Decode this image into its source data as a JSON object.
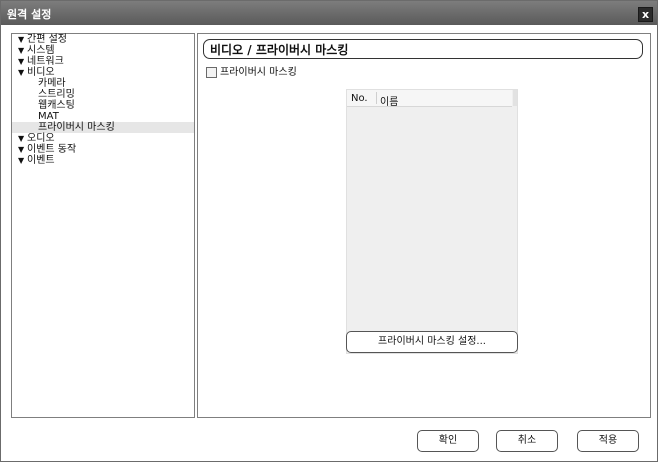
{
  "window": {
    "title": "원격 설정",
    "close_label": "x"
  },
  "tree": {
    "items": [
      {
        "label": "간편 설정",
        "arrow": "▼"
      },
      {
        "label": "시스템",
        "arrow": "▼"
      },
      {
        "label": "네트워크",
        "arrow": "▼"
      },
      {
        "label": "비디오",
        "arrow": "▼"
      },
      {
        "label": "카메라"
      },
      {
        "label": "스트리밍"
      },
      {
        "label": "웹캐스팅"
      },
      {
        "label": "MAT"
      },
      {
        "label": "프라이버시 마스킹",
        "selected": true
      },
      {
        "label": "오디오",
        "arrow": "▼"
      },
      {
        "label": "이벤트 동작",
        "arrow": "▼"
      },
      {
        "label": "이벤트",
        "arrow": "▼"
      }
    ]
  },
  "content": {
    "section_title": "비디오 / 프라이버시 마스킹",
    "checkbox_label": "프라이버시 마스킹",
    "table": {
      "col_no": "No.",
      "col_name": "이름",
      "rows": []
    },
    "mask_button": "프라이버시 마스킹 설정..."
  },
  "footer": {
    "ok": "확인",
    "cancel": "취소",
    "apply": "적용"
  }
}
